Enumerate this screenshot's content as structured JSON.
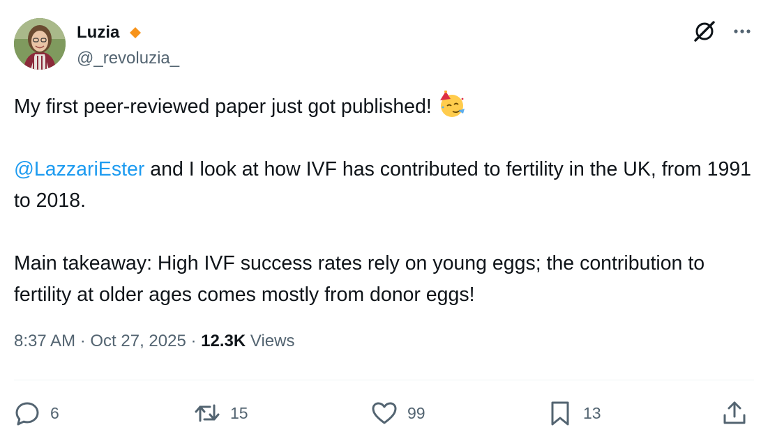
{
  "author": {
    "name": "Luzia",
    "handle": "@_revoluzia_",
    "badge_color": "#f7931a"
  },
  "post": {
    "line1": "My first peer-reviewed paper just got published!",
    "emoji": "partying-face-emoji",
    "mention": "@LazzariEster",
    "para2": " and I look at how IVF has contributed to fertility in the UK, from 1991 to 2018.",
    "para3": "Main takeaway: High IVF success rates rely on young eggs; the contribution to fertility at older ages comes mostly from donor eggs!"
  },
  "meta": {
    "time": "8:37 AM",
    "sep1": " · ",
    "date": "Oct 27, 2025",
    "sep2": " · ",
    "views_count": "12.3K",
    "views_label": " Views"
  },
  "actions": {
    "replies": "6",
    "reposts": "15",
    "likes": "99",
    "bookmarks": "13"
  },
  "icons": {
    "grok": "grok-icon",
    "more": "more-icon",
    "reply": "reply-icon",
    "repost": "repost-icon",
    "like": "heart-icon",
    "bookmark": "bookmark-icon",
    "share": "share-icon"
  },
  "colors": {
    "text": "#0f1419",
    "secondary": "#536471",
    "link": "#1d9bf0"
  }
}
